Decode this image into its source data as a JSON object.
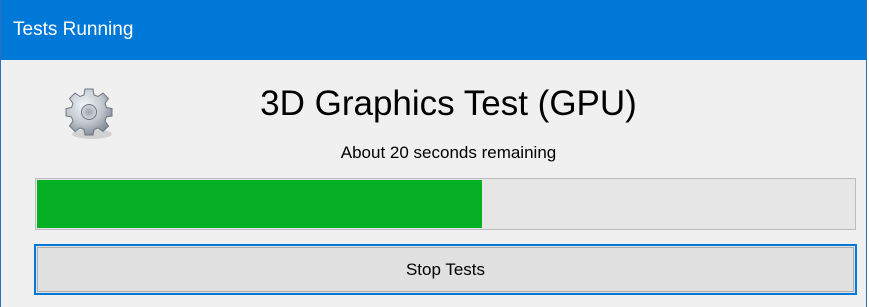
{
  "window": {
    "title": "Tests Running"
  },
  "test": {
    "icon": "gear-icon",
    "name": "3D Graphics Test (GPU)",
    "status": "About 20 seconds remaining"
  },
  "progress": {
    "fraction": 0.545,
    "color": "#06b025"
  },
  "actions": {
    "stop_label": "Stop Tests"
  },
  "colors": {
    "titlebar": "#0078d7",
    "focus_border": "#0078d7"
  }
}
